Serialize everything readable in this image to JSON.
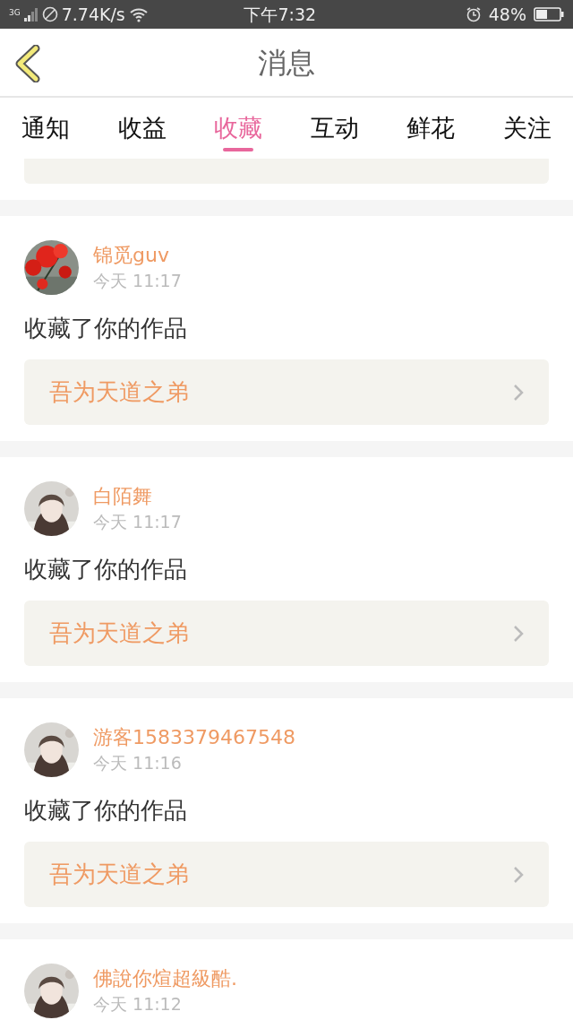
{
  "status_bar": {
    "network": "3G",
    "speed": "7.74K/s",
    "time": "下午7:32",
    "battery": "48%"
  },
  "header": {
    "title": "消息"
  },
  "tabs": [
    {
      "label": "通知",
      "selected": false
    },
    {
      "label": "收益",
      "selected": false
    },
    {
      "label": "收藏",
      "selected": true
    },
    {
      "label": "互动",
      "selected": false
    },
    {
      "label": "鲜花",
      "selected": false
    },
    {
      "label": "关注",
      "selected": false
    }
  ],
  "messages": [
    {
      "user": "锦觅guv",
      "time": "今天 11:17",
      "action": "收藏了你的作品",
      "work": "吾为天道之弟"
    },
    {
      "user": "白陌舞",
      "time": "今天 11:17",
      "action": "收藏了你的作品",
      "work": "吾为天道之弟"
    },
    {
      "user": "游客1583379467548",
      "time": "今天 11:16",
      "action": "收藏了你的作品",
      "work": "吾为天道之弟"
    },
    {
      "user": "佛說你煊超級酷.",
      "time": "今天 11:12"
    }
  ]
}
